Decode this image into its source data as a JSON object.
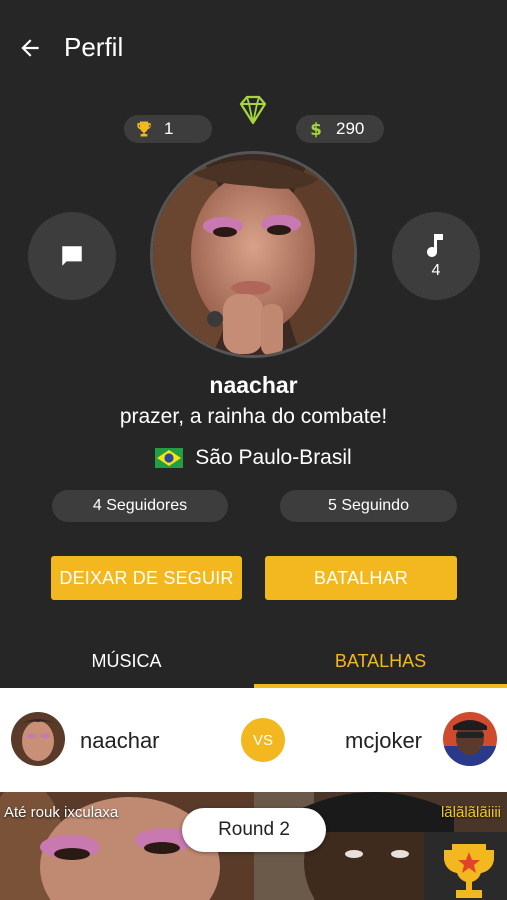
{
  "header": {
    "title": "Perfil"
  },
  "stats": {
    "trophies": "1",
    "coins": "290"
  },
  "actions": {
    "music_count": "4"
  },
  "profile": {
    "username": "naachar",
    "bio": "prazer, a rainha do combate!",
    "location": "São Paulo-Brasil",
    "followers": "4 Seguidores",
    "following": "5 Seguindo"
  },
  "buttons": {
    "unfollow": "DEIXAR DE SEGUIR",
    "battle": "BATALHAR"
  },
  "tabs": [
    {
      "label": "MÚSICA"
    },
    {
      "label": "BATALHAS"
    }
  ],
  "battle": {
    "player_left": "naachar",
    "vs": "VS",
    "player_right": "mcjoker",
    "caption_left": "Até rouk ixculaxa",
    "caption_right": "lãlãlãlãiiii",
    "round": "Round 2"
  },
  "colors": {
    "accent": "#f3b81f",
    "background": "#262626",
    "pill": "#3d3d3d",
    "diamond": "#a6d63a"
  },
  "icons": [
    "back-arrow-icon",
    "diamond-icon",
    "trophy-icon",
    "dollar-icon",
    "chat-icon",
    "music-note-icon",
    "brazil-flag-icon",
    "trophy-badge-icon"
  ]
}
